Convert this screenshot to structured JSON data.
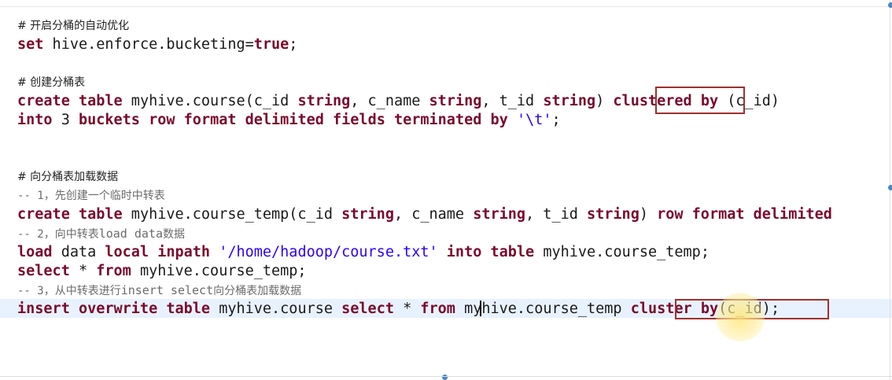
{
  "editor": {
    "l1": "# 开启分桶的自动优化",
    "l2": {
      "a": "set",
      "b": " hive.enforce.bucketing=",
      "c": "true",
      "d": ";"
    },
    "l3": "# 创建分桶表",
    "l4": {
      "a": "create",
      "b": " ",
      "c": "table",
      "d": " myhive.course(c_id ",
      "e": "string",
      "f": ", c_name ",
      "g": "string",
      "h": ", t_id ",
      "i": "string",
      "j": ") ",
      "k": "clustered",
      "l": " ",
      "m": "by",
      "n": " (c_id)"
    },
    "l5": {
      "a": "into",
      "b": " 3 ",
      "c": "buckets",
      "d": " ",
      "e": "row",
      "f": " ",
      "g": "format",
      "h": " ",
      "i": "delimited",
      "j": " ",
      "k": "fields",
      "l": " ",
      "m": "terminated",
      "n": " ",
      "o": "by",
      "p": " ",
      "q": "'\\t'",
      "r": ";"
    },
    "l6": "# 向分桶表加载数据",
    "l7": "-- 1，先创建一个临时中转表",
    "l8": {
      "a": "create",
      "b": " ",
      "c": "table",
      "d": " myhive.course_temp(c_id ",
      "e": "string",
      "f": ", c_name ",
      "g": "string",
      "h": ", t_id ",
      "i": "string",
      "j": ") ",
      "k": "row",
      "l": " ",
      "m": "format",
      "n": " ",
      "o": "delimited"
    },
    "l9": {
      "a": "-- 2，向中转表",
      "b": "load data",
      "c": "数据"
    },
    "l10": {
      "a": "load",
      "b": " data ",
      "c": "local",
      "d": " ",
      "e": "inpath",
      "f": " ",
      "g": "'/home/hadoop/course.txt'",
      "h": " ",
      "i": "into",
      "j": " ",
      "k": "table",
      "l": " myhive.course_temp;"
    },
    "l11": {
      "a": "select",
      "b": " * ",
      "c": "from",
      "d": " myhive.course_temp;"
    },
    "l12": {
      "a": "-- 3，从中转表进行",
      "b": "insert select",
      "c": "向分桶表加载数据"
    },
    "l13": {
      "a": "insert",
      "b": " ",
      "c": "overwrite",
      "d": " ",
      "e": "table",
      "f": " myhive.course ",
      "g": "select",
      "h": " * ",
      "i": "from",
      "j": " myhive.course_temp ",
      "k": "cluster",
      "l": " ",
      "m": "by",
      "n": "(c_id)",
      "o": ";"
    }
  }
}
